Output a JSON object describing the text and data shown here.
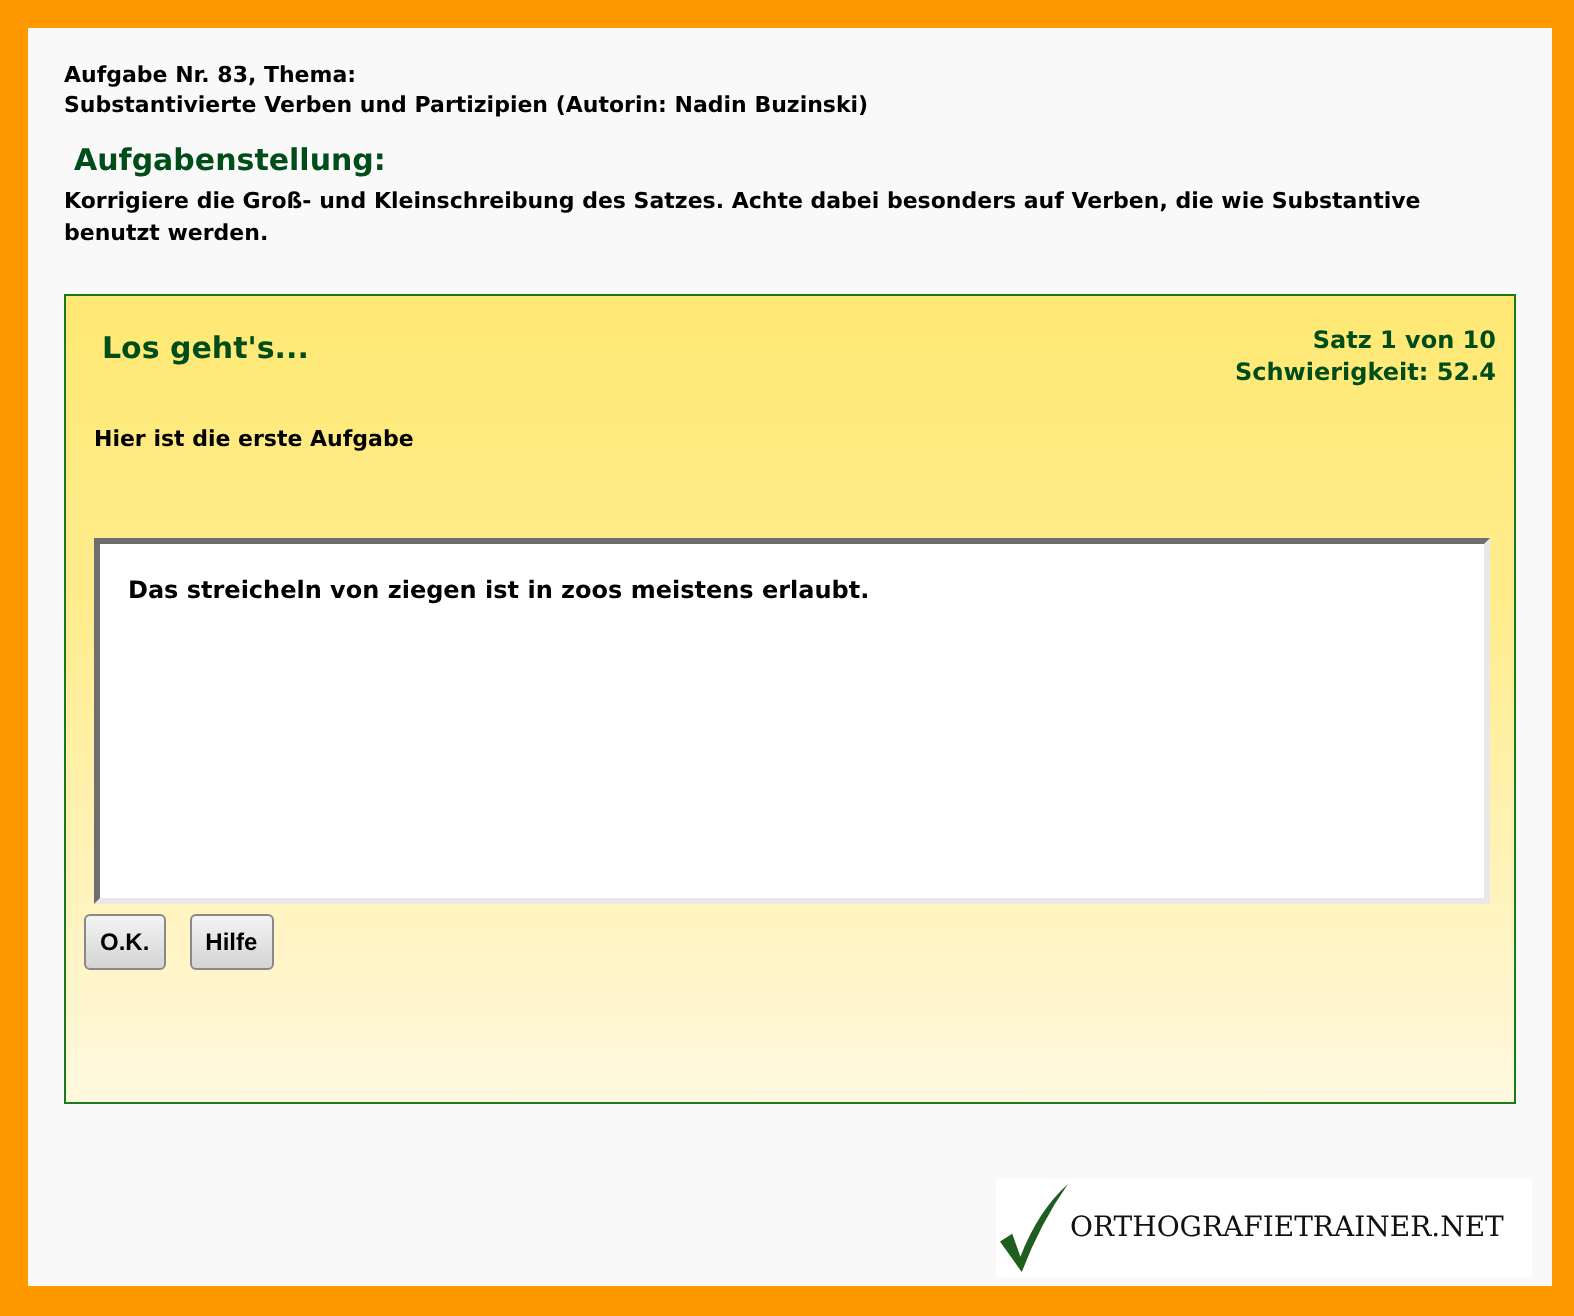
{
  "header": {
    "task_line": "Aufgabe Nr. 83, Thema:",
    "topic_line": "Substantivierte Verben und Partizipien (Autorin: Nadin Buzinski)"
  },
  "instructions": {
    "heading": "Aufgabenstellung:",
    "text": "Korrigiere die Groß- und Kleinschreibung des Satzes. Achte dabei besonders auf Verben, die wie Substantive benutzt werden."
  },
  "exercise": {
    "title": "Los geht's...",
    "progress": "Satz 1 von 10",
    "difficulty": "Schwierigkeit: 52.4",
    "prompt": "Hier ist die erste Aufgabe",
    "answer": "Das streicheln von ziegen ist in zoos meistens erlaubt.",
    "buttons": [
      "O.K.",
      "Hilfe"
    ]
  },
  "logo": {
    "text": "ORTHOGRAFIETRAINER.NET"
  }
}
